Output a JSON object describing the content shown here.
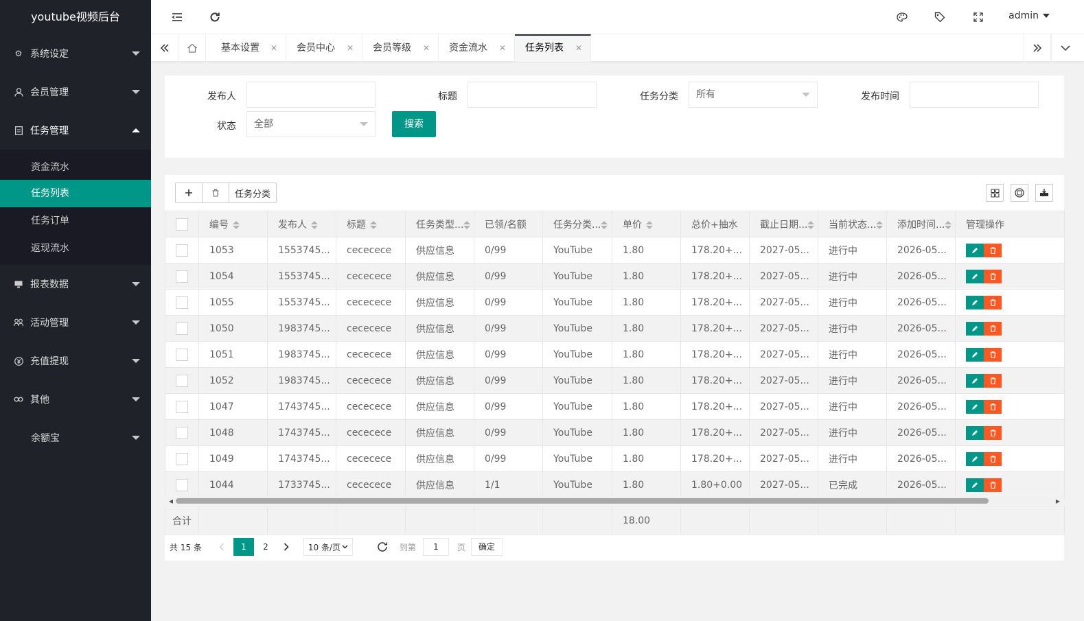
{
  "app": {
    "title": "youtube视频后台"
  },
  "sidebar": {
    "items": [
      {
        "label": "系统设定",
        "icon": "gear-icon"
      },
      {
        "label": "会员管理",
        "icon": "user-icon"
      },
      {
        "label": "任务管理",
        "icon": "file-icon",
        "expanded": true,
        "children": [
          {
            "label": "资金流水"
          },
          {
            "label": "任务列表",
            "active": true
          },
          {
            "label": "任务订单"
          },
          {
            "label": "返现流水"
          }
        ]
      },
      {
        "label": "报表数据",
        "icon": "monitor-icon"
      },
      {
        "label": "活动管理",
        "icon": "group-icon"
      },
      {
        "label": "充值提现",
        "icon": "yen-icon"
      },
      {
        "label": "其他",
        "icon": "link-icon"
      },
      {
        "label": "余额宝",
        "icon": ""
      }
    ]
  },
  "header": {
    "user": "admin"
  },
  "tabs": [
    {
      "label": "基本设置"
    },
    {
      "label": "会员中心"
    },
    {
      "label": "会员等级"
    },
    {
      "label": "资金流水"
    },
    {
      "label": "任务列表",
      "active": true
    }
  ],
  "search": {
    "publisher_label": "发布人",
    "title_label": "标题",
    "category_label": "任务分类",
    "category_value": "所有",
    "time_label": "发布时间",
    "status_label": "状态",
    "status_value": "全部",
    "search_button": "搜索"
  },
  "toolbar": {
    "category_button": "任务分类"
  },
  "table": {
    "columns": [
      "编号",
      "发布人",
      "标题",
      "任务类型...",
      "已领/名额",
      "任务分类...",
      "单价",
      "总价+抽水",
      "截止日期...",
      "当前状态...",
      "添加时间...",
      "管理操作"
    ],
    "rows": [
      [
        "1053",
        "1553745...",
        "cececece",
        "供应信息",
        "0/99",
        "YouTube",
        "1.80",
        "178.20+...",
        "2027-05...",
        "进行中",
        "2026-05..."
      ],
      [
        "1054",
        "1553745...",
        "cececece",
        "供应信息",
        "0/99",
        "YouTube",
        "1.80",
        "178.20+...",
        "2027-05...",
        "进行中",
        "2026-05..."
      ],
      [
        "1055",
        "1553745...",
        "cececece",
        "供应信息",
        "0/99",
        "YouTube",
        "1.80",
        "178.20+...",
        "2027-05...",
        "进行中",
        "2026-05..."
      ],
      [
        "1050",
        "1983745...",
        "cececece",
        "供应信息",
        "0/99",
        "YouTube",
        "1.80",
        "178.20+...",
        "2027-05...",
        "进行中",
        "2026-05..."
      ],
      [
        "1051",
        "1983745...",
        "cececece",
        "供应信息",
        "0/99",
        "YouTube",
        "1.80",
        "178.20+...",
        "2027-05...",
        "进行中",
        "2026-05..."
      ],
      [
        "1052",
        "1983745...",
        "cececece",
        "供应信息",
        "0/99",
        "YouTube",
        "1.80",
        "178.20+...",
        "2027-05...",
        "进行中",
        "2026-05..."
      ],
      [
        "1047",
        "1743745...",
        "cececece",
        "供应信息",
        "0/99",
        "YouTube",
        "1.80",
        "178.20+...",
        "2027-05...",
        "进行中",
        "2026-05..."
      ],
      [
        "1048",
        "1743745...",
        "cececece",
        "供应信息",
        "0/99",
        "YouTube",
        "1.80",
        "178.20+...",
        "2027-05...",
        "进行中",
        "2026-05..."
      ],
      [
        "1049",
        "1743745...",
        "cececece",
        "供应信息",
        "0/99",
        "YouTube",
        "1.80",
        "178.20+...",
        "2027-05...",
        "进行中",
        "2026-05..."
      ],
      [
        "1044",
        "1733745...",
        "cececece",
        "供应信息",
        "1/1",
        "YouTube",
        "1.80",
        "1.80+0.00",
        "2027-05...",
        "已完成",
        "2026-05..."
      ]
    ],
    "total_label": "合计",
    "total_price": "18.00"
  },
  "pagination": {
    "total_text": "共 15 条",
    "pages": [
      "1",
      "2"
    ],
    "current_page": "1",
    "page_size": "10 条/页",
    "goto_label": "到第",
    "goto_value": "1",
    "page_label": "页",
    "confirm": "确定"
  },
  "colors": {
    "accent": "#009688",
    "danger": "#ff5722",
    "sidebar": "#20222a"
  }
}
